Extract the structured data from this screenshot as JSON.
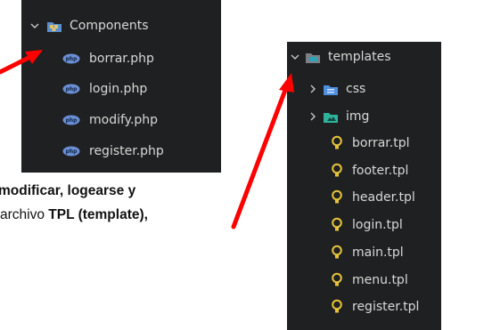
{
  "components_panel": {
    "folder": "Components",
    "files": [
      "borrar.php",
      "login.php",
      "modify.php",
      "register.php"
    ]
  },
  "templates_panel": {
    "folder": "templates",
    "subfolders": [
      "css",
      "img"
    ],
    "files": [
      "borrar.tpl",
      "footer.tpl",
      "header.tpl",
      "login.tpl",
      "main.tpl",
      "menu.tpl",
      "register.tpl"
    ]
  },
  "caption": {
    "line1_bold": "modificar, logearse y",
    "line2_prefix": "archivo ",
    "line2_bold": "TPL (template),"
  },
  "colors": {
    "panel_bg": "#1e2021",
    "arrow": "#ff0000",
    "php_icon": "#6b8fd6",
    "tpl_icon": "#e8c33a",
    "css_folder": "#4f8fe0",
    "img_folder": "#2fb39a"
  },
  "icons": {
    "expanded": "chevron-down-icon",
    "collapsed": "chevron-right-icon",
    "php": "php-file-icon",
    "tpl": "lightbulb-icon"
  }
}
